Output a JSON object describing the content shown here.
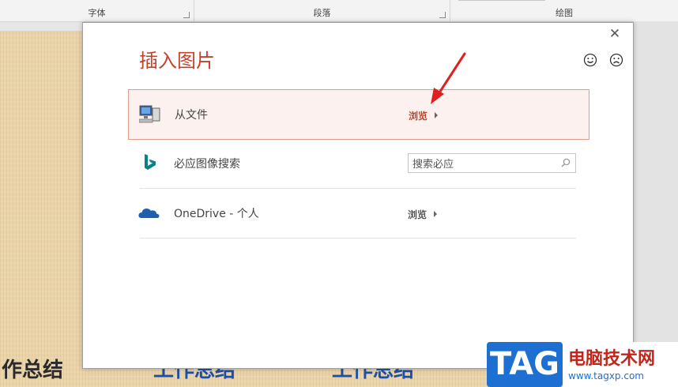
{
  "ribbon": {
    "groups": [
      "字体",
      "段落",
      "绘图"
    ]
  },
  "slide": {
    "texts": [
      "作总结",
      "工作总结",
      "工作总结"
    ],
    "colors": {
      "dark": "#2a2a2a",
      "blue": "#1e4fa8"
    }
  },
  "dialog": {
    "title": "插入图片",
    "close_icon": "close-icon",
    "feedback": {
      "smile_icon": "smile-icon",
      "frown_icon": "frown-icon"
    },
    "rows": [
      {
        "icon": "computer-icon",
        "label": "从文件",
        "action": "浏览",
        "selected": true
      },
      {
        "icon": "bing-icon",
        "label": "必应图像搜索",
        "search_value": "搜索必应"
      },
      {
        "icon": "onedrive-icon",
        "label": "OneDrive - 个人",
        "action": "浏览"
      }
    ]
  },
  "annotation": {
    "arrow_color": "#e02020"
  },
  "watermark": {
    "tag": "TAG",
    "title": "电脑技术网",
    "url": "www.tagxp.com"
  },
  "colors": {
    "accent": "#c4422c",
    "selected_bg": "#fcf1ee",
    "selected_border": "#df9d8c",
    "watermark_blue": "#1d6fd1"
  }
}
